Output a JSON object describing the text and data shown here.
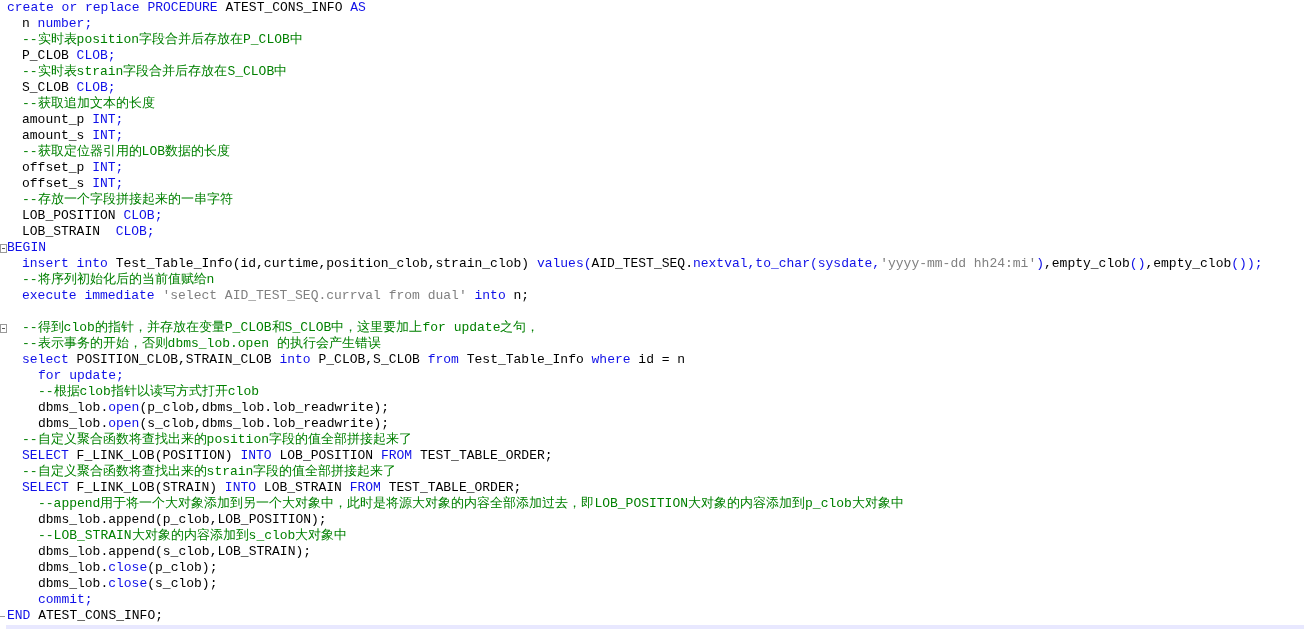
{
  "lines": [
    {
      "kind": "top",
      "tokens": [
        {
          "kind": "keyword",
          "t": "create or replace PROCEDURE"
        },
        {
          "kind": "plain",
          "t": " ATEST_CONS_INFO "
        },
        {
          "kind": "keyword",
          "t": "AS"
        }
      ]
    },
    {
      "kind": "body",
      "tokens": [
        {
          "kind": "plain",
          "t": "n "
        },
        {
          "kind": "keyword",
          "t": "number;"
        }
      ]
    },
    {
      "kind": "body",
      "tokens": [
        {
          "kind": "comment",
          "t": "--实时表position字段合并后存放在P_CLOB中"
        }
      ]
    },
    {
      "kind": "body",
      "tokens": [
        {
          "kind": "plain",
          "t": "P_CLOB "
        },
        {
          "kind": "keyword",
          "t": "CLOB;"
        }
      ]
    },
    {
      "kind": "body",
      "tokens": [
        {
          "kind": "comment",
          "t": "--实时表strain字段合并后存放在S_CLOB中"
        }
      ]
    },
    {
      "kind": "body",
      "tokens": [
        {
          "kind": "plain",
          "t": "S_CLOB "
        },
        {
          "kind": "keyword",
          "t": "CLOB;"
        }
      ]
    },
    {
      "kind": "body",
      "tokens": [
        {
          "kind": "comment",
          "t": "--获取追加文本的长度"
        }
      ]
    },
    {
      "kind": "body",
      "tokens": [
        {
          "kind": "plain",
          "t": "amount_p "
        },
        {
          "kind": "keyword",
          "t": "INT;"
        }
      ]
    },
    {
      "kind": "body",
      "tokens": [
        {
          "kind": "plain",
          "t": "amount_s "
        },
        {
          "kind": "keyword",
          "t": "INT;"
        }
      ]
    },
    {
      "kind": "body",
      "tokens": [
        {
          "kind": "comment",
          "t": "--获取定位器引用的LOB数据的长度"
        }
      ]
    },
    {
      "kind": "body",
      "tokens": [
        {
          "kind": "plain",
          "t": "offset_p "
        },
        {
          "kind": "keyword",
          "t": "INT;"
        }
      ]
    },
    {
      "kind": "body",
      "tokens": [
        {
          "kind": "plain",
          "t": "offset_s "
        },
        {
          "kind": "keyword",
          "t": "INT;"
        }
      ]
    },
    {
      "kind": "body",
      "tokens": [
        {
          "kind": "comment",
          "t": "--存放一个字段拼接起来的一串字符"
        }
      ]
    },
    {
      "kind": "body",
      "tokens": [
        {
          "kind": "plain",
          "t": "LOB_POSITION "
        },
        {
          "kind": "keyword",
          "t": "CLOB;"
        }
      ]
    },
    {
      "kind": "body",
      "tokens": [
        {
          "kind": "plain",
          "t": "LOB_STRAIN  "
        },
        {
          "kind": "keyword",
          "t": "CLOB;"
        }
      ]
    },
    {
      "kind": "begin",
      "tokens": [
        {
          "kind": "keyword",
          "t": "BEGIN"
        }
      ]
    },
    {
      "kind": "body",
      "tokens": [
        {
          "kind": "keyword",
          "t": "insert into"
        },
        {
          "kind": "plain",
          "t": " Test_Table_Info(id,curtime,position_clob,strain_clob) "
        },
        {
          "kind": "keyword",
          "t": "values("
        },
        {
          "kind": "plain",
          "t": "AID_TEST_SEQ."
        },
        {
          "kind": "keyword",
          "t": "nextval,to_char(sysdate,"
        },
        {
          "kind": "string",
          "t": "'yyyy-mm-dd hh24:mi'"
        },
        {
          "kind": "keyword",
          "t": ")"
        },
        {
          "kind": "plain",
          "t": ",empty_clob"
        },
        {
          "kind": "keyword",
          "t": "()"
        },
        {
          "kind": "plain",
          "t": ",empty_clob"
        },
        {
          "kind": "keyword",
          "t": "());"
        }
      ]
    },
    {
      "kind": "body",
      "tokens": [
        {
          "kind": "comment",
          "t": "--将序列初始化后的当前值赋给n"
        }
      ]
    },
    {
      "kind": "body",
      "tokens": [
        {
          "kind": "keyword",
          "t": "execute immediate "
        },
        {
          "kind": "string",
          "t": "'select AID_TEST_SEQ.currval from dual'"
        },
        {
          "kind": "keyword",
          "t": " into"
        },
        {
          "kind": "plain",
          "t": " n;"
        }
      ]
    },
    {
      "kind": "blank"
    },
    {
      "kind": "foldbody",
      "tokens": [
        {
          "kind": "comment",
          "t": "--得到clob的指针，并存放在变量P_CLOB和S_CLOB中，这里要加上for update之句，"
        }
      ]
    },
    {
      "kind": "body",
      "tokens": [
        {
          "kind": "comment",
          "t": "--表示事务的开始，否则dbms_lob.open 的执行会产生错误"
        }
      ]
    },
    {
      "kind": "body",
      "tokens": [
        {
          "kind": "keyword",
          "t": "select"
        },
        {
          "kind": "plain",
          "t": " POSITION_CLOB,STRAIN_CLOB "
        },
        {
          "kind": "keyword",
          "t": "into"
        },
        {
          "kind": "plain",
          "t": " P_CLOB,S_CLOB "
        },
        {
          "kind": "keyword",
          "t": "from"
        },
        {
          "kind": "plain",
          "t": " Test_Table_Info "
        },
        {
          "kind": "keyword",
          "t": "where"
        },
        {
          "kind": "plain",
          "t": " id = n"
        }
      ]
    },
    {
      "kind": "nested",
      "tokens": [
        {
          "kind": "keyword",
          "t": "for update;"
        }
      ]
    },
    {
      "kind": "nested",
      "tokens": [
        {
          "kind": "comment",
          "t": "--根据clob指针以读写方式打开clob"
        }
      ]
    },
    {
      "kind": "nested",
      "tokens": [
        {
          "kind": "plain",
          "t": "dbms_lob."
        },
        {
          "kind": "keyword",
          "t": "open"
        },
        {
          "kind": "plain",
          "t": "(p_clob,dbms_lob.lob_readwrite);"
        }
      ]
    },
    {
      "kind": "nested",
      "tokens": [
        {
          "kind": "plain",
          "t": "dbms_lob."
        },
        {
          "kind": "keyword",
          "t": "open"
        },
        {
          "kind": "plain",
          "t": "(s_clob,dbms_lob.lob_readwrite);"
        }
      ]
    },
    {
      "kind": "body",
      "tokens": [
        {
          "kind": "comment",
          "t": "--自定义聚合函数将查找出来的position字段的值全部拼接起来了"
        }
      ]
    },
    {
      "kind": "body",
      "tokens": [
        {
          "kind": "keyword",
          "t": "SELECT"
        },
        {
          "kind": "plain",
          "t": " F_LINK_LOB(POSITION) "
        },
        {
          "kind": "keyword",
          "t": "INTO"
        },
        {
          "kind": "plain",
          "t": " LOB_POSITION "
        },
        {
          "kind": "keyword",
          "t": "FROM"
        },
        {
          "kind": "plain",
          "t": " TEST_TABLE_ORDER;"
        }
      ]
    },
    {
      "kind": "body",
      "tokens": [
        {
          "kind": "comment",
          "t": "--自定义聚合函数将查找出来的strain字段的值全部拼接起来了"
        }
      ]
    },
    {
      "kind": "body",
      "tokens": [
        {
          "kind": "keyword",
          "t": "SELECT"
        },
        {
          "kind": "plain",
          "t": " F_LINK_LOB(STRAIN) "
        },
        {
          "kind": "keyword",
          "t": "INTO"
        },
        {
          "kind": "plain",
          "t": " LOB_STRAIN "
        },
        {
          "kind": "keyword",
          "t": "FROM"
        },
        {
          "kind": "plain",
          "t": " TEST_TABLE_ORDER;"
        }
      ]
    },
    {
      "kind": "nested",
      "tokens": [
        {
          "kind": "comment",
          "t": "--append用于将一个大对象添加到另一个大对象中，此时是将源大对象的内容全部添加过去，即LOB_POSITION大对象的内容添加到p_clob大对象中"
        }
      ]
    },
    {
      "kind": "nested",
      "tokens": [
        {
          "kind": "plain",
          "t": "dbms_lob.append(p_clob,LOB_POSITION);"
        }
      ]
    },
    {
      "kind": "nested",
      "tokens": [
        {
          "kind": "comment",
          "t": "--LOB_STRAIN大对象的内容添加到s_clob大对象中"
        }
      ]
    },
    {
      "kind": "nested",
      "tokens": [
        {
          "kind": "plain",
          "t": "dbms_lob.append(s_clob,LOB_STRAIN);"
        }
      ]
    },
    {
      "kind": "nested",
      "tokens": [
        {
          "kind": "plain",
          "t": "dbms_lob."
        },
        {
          "kind": "keyword",
          "t": "close"
        },
        {
          "kind": "plain",
          "t": "(p_clob);"
        }
      ]
    },
    {
      "kind": "nested",
      "tokens": [
        {
          "kind": "plain",
          "t": "dbms_lob."
        },
        {
          "kind": "keyword",
          "t": "close"
        },
        {
          "kind": "plain",
          "t": "(s_clob);"
        }
      ]
    },
    {
      "kind": "nested",
      "tokens": [
        {
          "kind": "keyword",
          "t": "commit;"
        }
      ]
    },
    {
      "kind": "end",
      "tokens": [
        {
          "kind": "keyword",
          "t": "END"
        },
        {
          "kind": "plain",
          "t": " ATEST_CONS_INFO;"
        }
      ]
    }
  ]
}
